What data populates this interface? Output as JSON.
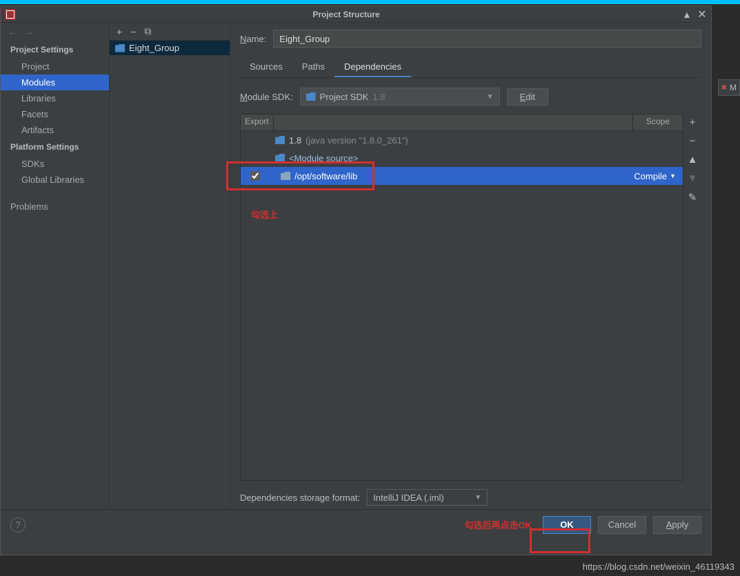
{
  "titlebar": {
    "title": "Project Structure"
  },
  "sidebar": {
    "section1": "Project Settings",
    "items1": [
      "Project",
      "Modules",
      "Libraries",
      "Facets",
      "Artifacts"
    ],
    "section2": "Platform Settings",
    "items2": [
      "SDKs",
      "Global Libraries"
    ],
    "problems": "Problems"
  },
  "middle": {
    "module": "Eight_Group"
  },
  "detail": {
    "name_label": "Name:",
    "name_value": "Eight_Group",
    "tabs": [
      "Sources",
      "Paths",
      "Dependencies"
    ],
    "sdk_label": "Module SDK:",
    "sdk_value_a": "Project SDK",
    "sdk_value_b": "1.8",
    "edit_label": "Edit",
    "head_export": "Export",
    "head_scope": "Scope",
    "rows": [
      {
        "text": "1.8",
        "dim": "(java version \"1.8.0_261\")"
      },
      {
        "text": "<Module source>"
      },
      {
        "text": "/opt/software/lib",
        "scope": "Compile"
      }
    ],
    "annot1": "勾选上",
    "storage_label": "Dependencies storage format:",
    "storage_value": "IntelliJ IDEA (.iml)"
  },
  "footer": {
    "annot2": "勾选后再点击OK",
    "ok": "OK",
    "cancel": "Cancel",
    "apply": "Apply"
  },
  "rightbadge": "M",
  "blogurl": "https://blog.csdn.net/weixin_46119343"
}
